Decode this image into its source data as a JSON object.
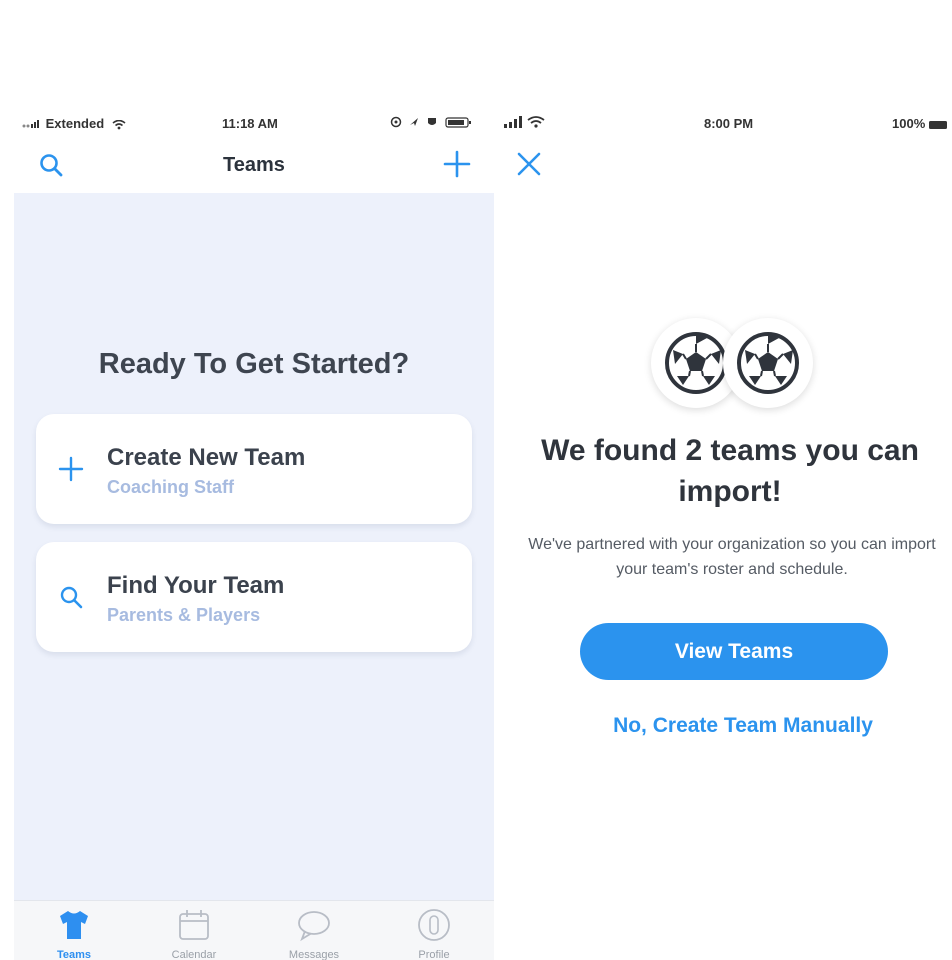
{
  "left": {
    "status": {
      "carrier": "Extended",
      "time": "11:18 AM"
    },
    "nav": {
      "title": "Teams",
      "search_icon": "search-icon",
      "add_icon": "plus-icon"
    },
    "heading": "Ready To Get Started?",
    "cards": [
      {
        "title": "Create New Team",
        "subtitle": "Coaching Staff",
        "icon": "plus-icon"
      },
      {
        "title": "Find Your Team",
        "subtitle": "Parents & Players",
        "icon": "search-icon"
      }
    ],
    "tabs": [
      {
        "label": "Teams",
        "icon": "jersey-icon",
        "active": true
      },
      {
        "label": "Calendar",
        "icon": "calendar-icon",
        "active": false
      },
      {
        "label": "Messages",
        "icon": "chat-bubble-icon",
        "active": false
      },
      {
        "label": "Profile",
        "icon": "profile-icon",
        "active": false
      }
    ]
  },
  "right": {
    "status": {
      "time": "8:00 PM",
      "battery": "100%"
    },
    "close_icon": "close-icon",
    "badge_icon": "soccer-ball-icon",
    "title": "We found 2 teams you can import!",
    "body": "We've partnered with your organization so you can import your team's roster and schedule.",
    "primary_button": "View Teams",
    "secondary_link": "No, Create Team Manually"
  },
  "colors": {
    "accent": "#2b93ee",
    "background_light": "#edf1fb",
    "subtitle": "#a7bbe0",
    "text_dark": "#2f343c"
  }
}
